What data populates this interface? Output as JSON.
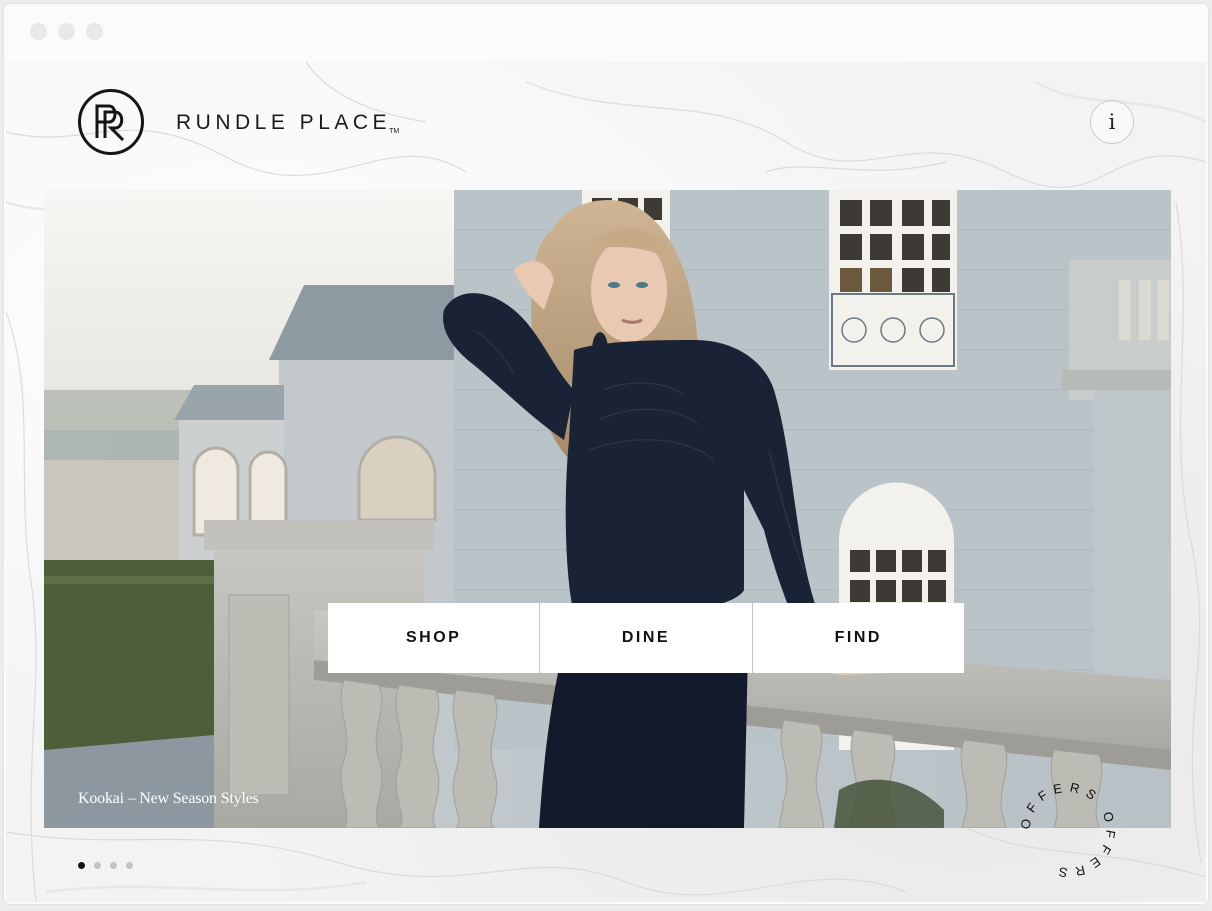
{
  "window": {
    "controls": [
      "close",
      "minimize",
      "maximize"
    ]
  },
  "header": {
    "logo_icon": "rp-monogram-icon",
    "brand_name": "RUNDLE PLACE",
    "brand_tm": "TM",
    "info_label": "i",
    "info_icon": "info-icon"
  },
  "nav": {
    "items": [
      {
        "label": "SHOP"
      },
      {
        "label": "DINE"
      },
      {
        "label": "FIND"
      }
    ]
  },
  "hero": {
    "caption": "Kookai – New Season Styles",
    "slide_count": 4,
    "active_slide": 1
  },
  "offers_badge": {
    "text": "OFFERS OFFERS"
  },
  "colors": {
    "text": "#111111",
    "background": "#f3f3f3",
    "nav_bg": "#ffffff"
  }
}
